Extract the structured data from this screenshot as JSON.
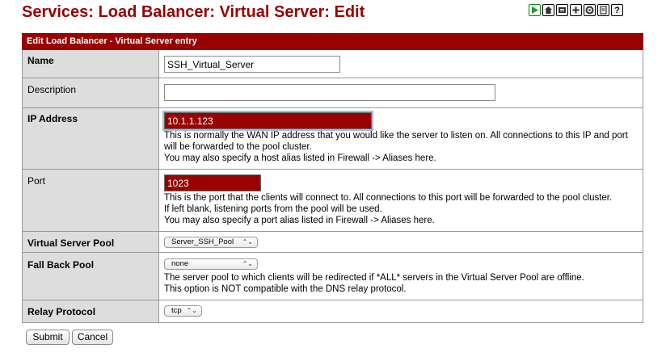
{
  "page": {
    "title": "Services: Load Balancer: Virtual Server: Edit"
  },
  "toolbar": {
    "icons": [
      "play-icon",
      "home-icon",
      "log-icon",
      "add-icon",
      "gear-icon",
      "notes-icon",
      "help-icon"
    ],
    "help_glyph": "?"
  },
  "form": {
    "section_title": "Edit Load Balancer - Virtual Server entry",
    "name": {
      "label": "Name",
      "value": "SSH_Virtual_Server"
    },
    "description": {
      "label": "Description",
      "value": ""
    },
    "ip_address": {
      "label": "IP Address",
      "value": "10.1.1.123",
      "help_1": "This is normally the WAN IP address that you would like the server to listen on. All connections to this IP and port will be forwarded to the pool cluster.",
      "help_2": "You may also specify a host alias listed in Firewall -> Aliases here."
    },
    "port": {
      "label": "Port",
      "value": "1023",
      "help_1": "This is the port that the clients will connect to. All connections to this port will be forwarded to the pool cluster.",
      "help_2": "If left blank, listening ports from the pool will be used.",
      "help_3": "You may also specify a port alias listed in Firewall -> Aliases here."
    },
    "virtual_server_pool": {
      "label": "Virtual Server Pool",
      "selected": "Server_SSH_Pool"
    },
    "fall_back_pool": {
      "label": "Fall Back Pool",
      "selected": "none",
      "help_1": "The server pool to which clients will be redirected if *ALL* servers in the Virtual Server Pool are offline.",
      "help_2": "This option is NOT compatible with the DNS relay protocol."
    },
    "relay_protocol": {
      "label": "Relay Protocol",
      "selected": "tcp"
    }
  },
  "buttons": {
    "submit": "Submit",
    "cancel": "Cancel"
  },
  "colors": {
    "accent": "#990000",
    "label_bg": "#dddddd",
    "play_green": "#1ea01e"
  }
}
